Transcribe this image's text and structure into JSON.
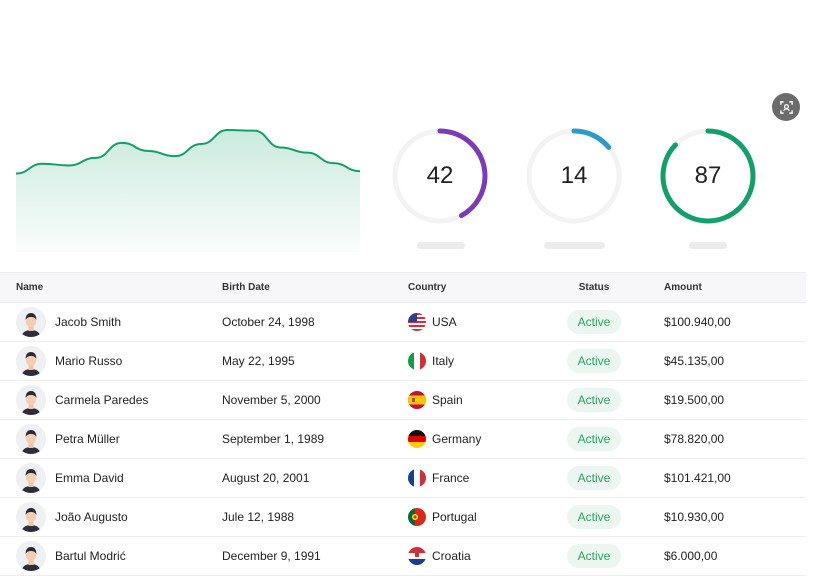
{
  "gauges": [
    {
      "value": "42",
      "fraction": 0.42,
      "color": "#7b3ab8"
    },
    {
      "value": "14",
      "fraction": 0.14,
      "color": "#2a9ccc"
    },
    {
      "value": "87",
      "fraction": 0.87,
      "color": "#12a06a"
    }
  ],
  "area_chart": {
    "color": "#12a06a",
    "values": [
      0.18,
      0.35,
      0.32,
      0.45,
      0.71,
      0.57,
      0.48,
      0.69,
      0.93,
      0.92,
      0.63,
      0.54,
      0.36,
      0.22
    ]
  },
  "table": {
    "headers": {
      "name": "Name",
      "birth_date": "Birth Date",
      "country": "Country",
      "status": "Status",
      "amount": "Amount"
    },
    "rows": [
      {
        "name": "Jacob Smith",
        "birth_date": "October 24, 1998",
        "country": "USA",
        "flag": "usa-flag-icon",
        "status": "Active",
        "amount": "$100.940,00"
      },
      {
        "name": "Mario Russo",
        "birth_date": "May 22, 1995",
        "country": "Italy",
        "flag": "italy-flag-icon",
        "status": "Active",
        "amount": "$45.135,00"
      },
      {
        "name": "Carmela Paredes",
        "birth_date": "November 5, 2000",
        "country": "Spain",
        "flag": "spain-flag-icon",
        "status": "Active",
        "amount": "$19.500,00"
      },
      {
        "name": "Petra Müller",
        "birth_date": "September 1, 1989",
        "country": "Germany",
        "flag": "germany-flag-icon",
        "status": "Active",
        "amount": "$78.820,00"
      },
      {
        "name": "Emma David",
        "birth_date": "August 20, 2001",
        "country": "France",
        "flag": "france-flag-icon",
        "status": "Active",
        "amount": "$101.421,00"
      },
      {
        "name": "João Augusto",
        "birth_date": "Jule 12, 1988",
        "country": "Portugal",
        "flag": "portugal-flag-icon",
        "status": "Active",
        "amount": "$10.930,00"
      },
      {
        "name": "Bartul Modrić",
        "birth_date": "December 9, 1991",
        "country": "Croatia",
        "flag": "croatia-flag-icon",
        "status": "Active",
        "amount": "$6.000,00"
      }
    ]
  }
}
